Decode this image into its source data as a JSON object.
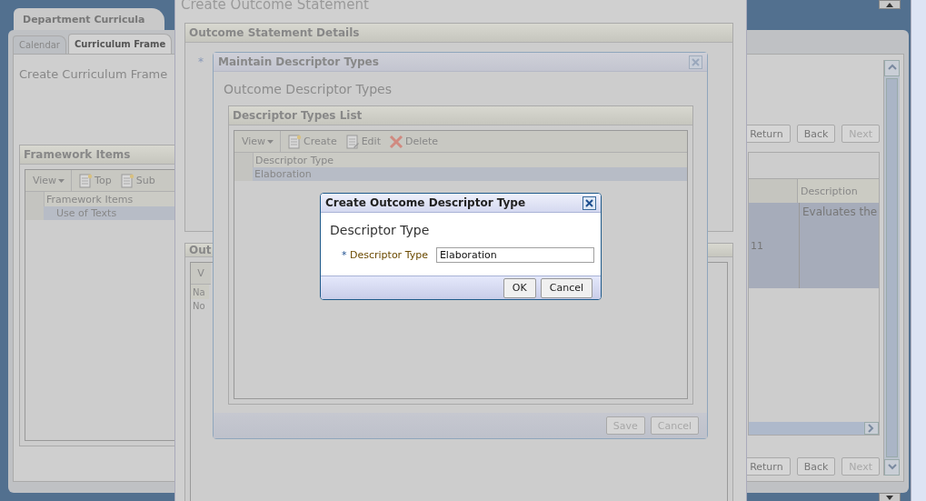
{
  "app": {
    "main_tab": "Department Curricula",
    "tabs": [
      {
        "label": "Calendar",
        "selected": false
      },
      {
        "label": "Curriculum Frame",
        "selected": true
      }
    ],
    "page_title": "Create Curriculum Frame",
    "nav_buttons_top": [
      {
        "label": "Return",
        "disabled": false
      },
      {
        "label": "Back",
        "disabled": false
      },
      {
        "label": "Next",
        "disabled": true
      }
    ],
    "framework_panel": {
      "title": "Framework Items",
      "toolbar": [
        {
          "kind": "menu",
          "label": "View"
        },
        {
          "kind": "create",
          "label": "Top"
        },
        {
          "kind": "create",
          "label": "Sub"
        }
      ],
      "column": "Framework Items",
      "rows": [
        {
          "text": "Use of Texts",
          "selected": true
        }
      ]
    },
    "detail_table": {
      "column": "Description",
      "cell_number": "11",
      "cell_description": "Evaluates the"
    },
    "nav_buttons_bottom": [
      {
        "label": "Return",
        "disabled": false
      },
      {
        "label": "Back",
        "disabled": false
      },
      {
        "label": "Next",
        "disabled": true
      }
    ]
  },
  "outcome_dialog": {
    "title": "Create Outcome Statement",
    "panel_title": "Outcome Statement Details",
    "required_mark": "*",
    "panel2_title": "Out",
    "toolbar_label": "V",
    "column": "Na",
    "empty_text": "No"
  },
  "descriptor_dialog": {
    "title": "Maintain Descriptor Types",
    "heading": "Outcome Descriptor Types",
    "panel_title": "Descriptor Types List",
    "toolbar": [
      {
        "kind": "menu",
        "label": "View"
      },
      {
        "kind": "create",
        "label": "Create"
      },
      {
        "kind": "edit",
        "label": "Edit"
      },
      {
        "kind": "delete",
        "label": "Delete"
      }
    ],
    "column": "Descriptor Type",
    "rows": [
      {
        "text": "Elaboration",
        "selected": true
      }
    ],
    "buttons": [
      {
        "label": "Save",
        "disabled": true
      },
      {
        "label": "Cancel",
        "disabled": true
      }
    ]
  },
  "type_dialog": {
    "title": "Create Outcome Descriptor Type",
    "heading": "Descriptor Type",
    "required_mark": "*",
    "field_label": "Descriptor Type",
    "field_value": "Elaboration",
    "buttons": [
      {
        "label": "OK"
      },
      {
        "label": "Cancel"
      }
    ]
  }
}
